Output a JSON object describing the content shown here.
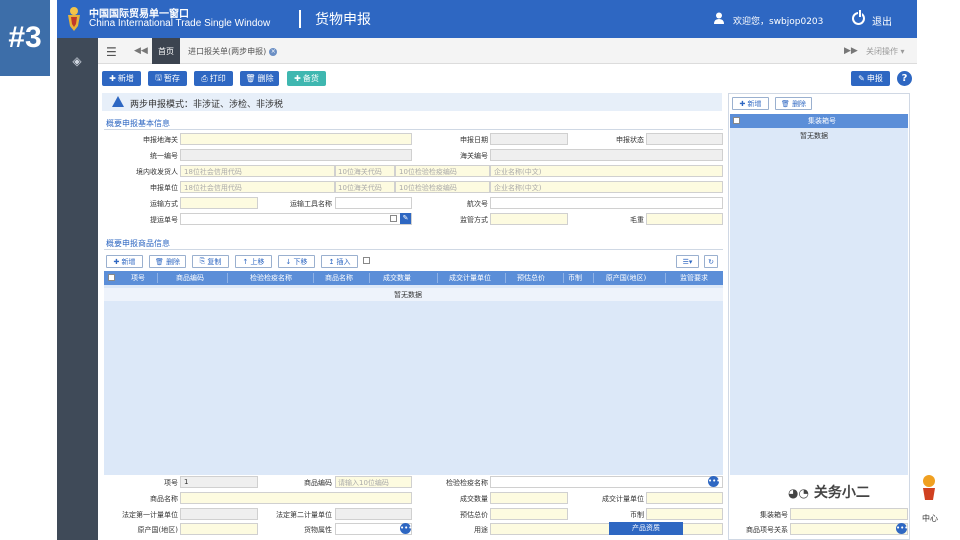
{
  "slide_badge": "#3",
  "header": {
    "brand_cn": "中国国际贸易单一窗口",
    "brand_en": "China International Trade Single Window",
    "module": "货物申报",
    "welcome": "欢迎您，swbjop0203",
    "logout": "退出"
  },
  "tabs": {
    "home": "首页",
    "current": "进口报关单(两步申报)",
    "close_ops": "关闭操作"
  },
  "toolbar": {
    "new": "新增",
    "save": "暂存",
    "print": "打印",
    "delete": "删除",
    "remark": "备货",
    "declare": "申报",
    "help": "?"
  },
  "mode": "两步申报模式：非涉证、涉检、非涉税",
  "basic": {
    "title": "概要申报基本信息",
    "declare_customs": "申报地海关",
    "declare_date": "申报日期",
    "declare_status": "申报状态",
    "unified_no": "统一编号",
    "customs_no": "海关编号",
    "consignee": "境内收发货人",
    "consignee_ph": "18位社会信用代码",
    "customs_code_ph": "10位海关代码",
    "inspect_code_ph": "10位检验检疫编码",
    "company_name_ph": "企业名称(中文)",
    "declare_unit": "申报单位",
    "transport_mode": "运输方式",
    "transport_name": "运输工具名称",
    "voyage_no": "航次号",
    "bill_no": "提运单号",
    "supervision_mode": "监管方式",
    "gross_weight": "毛重"
  },
  "goods": {
    "title": "概要申报商品信息",
    "buttons": {
      "new": "新增",
      "delete": "删除",
      "copy": "复制",
      "up": "上移",
      "down": "下移",
      "insert": "插入"
    },
    "columns": [
      "项号",
      "商品编码",
      "检验检疫名称",
      "商品名称",
      "成交数量",
      "成交计量单位",
      "预估总价",
      "币制",
      "原产国(地区)",
      "监管要求"
    ],
    "empty": "暂无数据"
  },
  "form": {
    "item_no": "项号",
    "item_no_value": "1",
    "hs_code": "商品编码",
    "hs_code_ph": "请输入10位编码",
    "ciq_name": "检验检疫名称",
    "goods_name": "商品名称",
    "deal_qty": "成交数量",
    "deal_unit": "成交计量单位",
    "legal_unit1": "法定第一计量单位",
    "legal_unit2": "法定第二计量单位",
    "est_total": "预估总价",
    "currency": "币制",
    "origin": "原产国(地区)",
    "goods_attr": "货物属性",
    "usage": "用途",
    "product_qual": "产品资质"
  },
  "container": {
    "new": "新增",
    "delete": "删除",
    "header": "集装箱号",
    "empty": "暂无数据",
    "container_no": "集装箱号",
    "goods_rel": "商品项号关系"
  },
  "watermark": "关务小二",
  "watermark_sub": "中心",
  "colors": {
    "primary": "#2e67c2",
    "table_header": "#5b8ed8",
    "required_field": "#fdfbe0",
    "sidebar": "#3f4a58"
  }
}
